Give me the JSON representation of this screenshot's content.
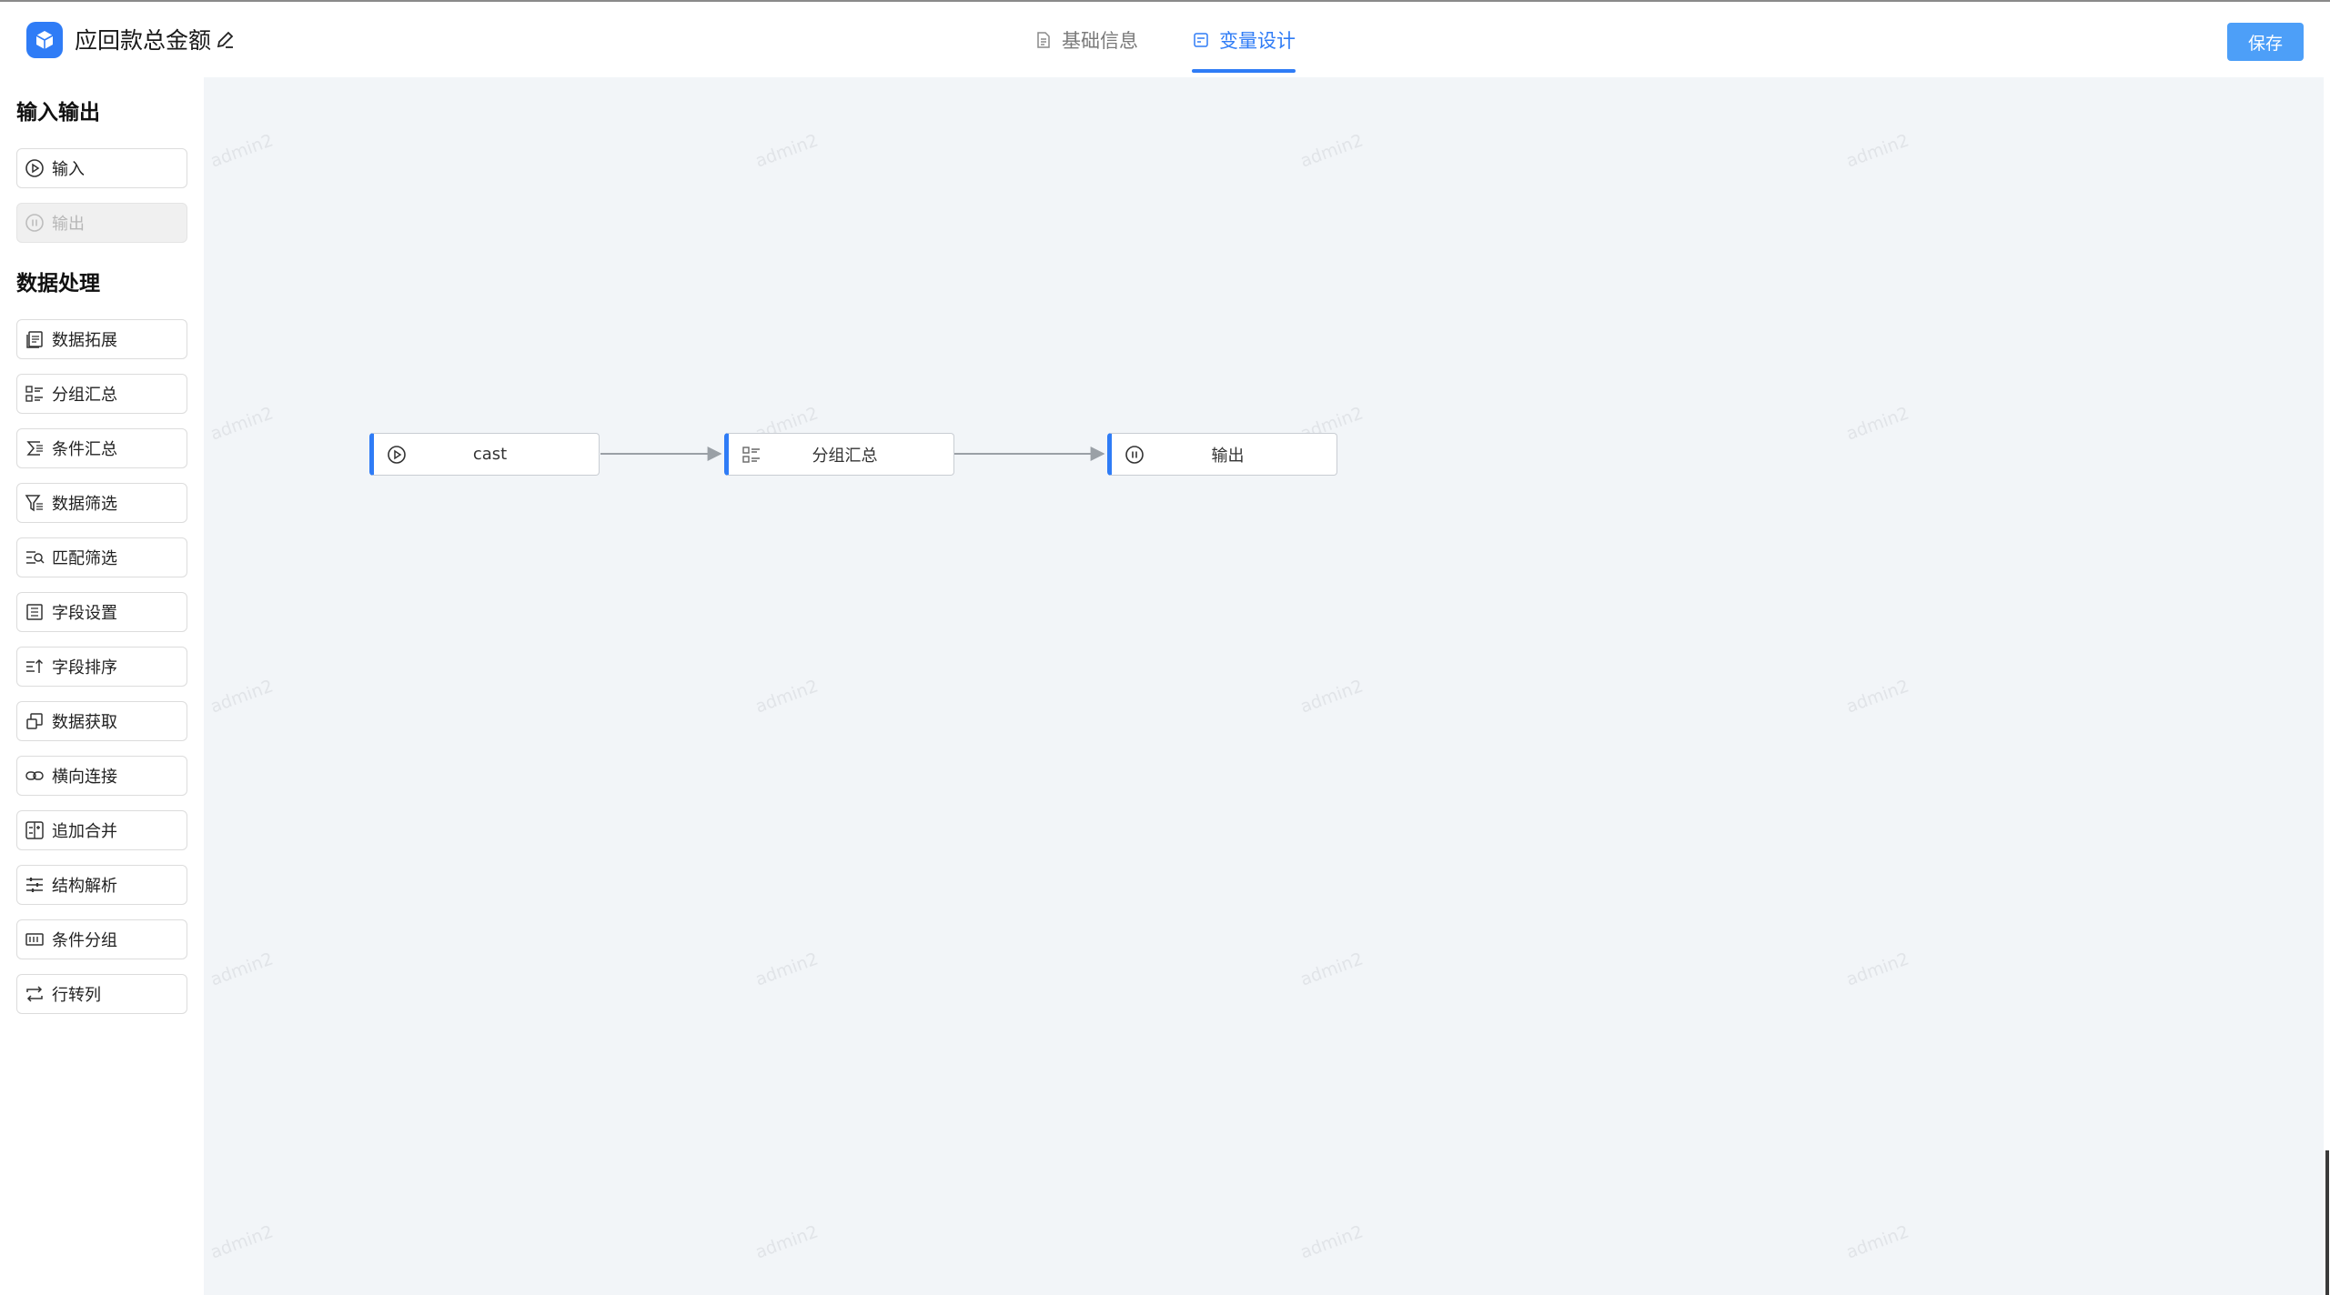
{
  "header": {
    "title": "应回款总金额",
    "tabs": [
      {
        "label": "基础信息",
        "active": false
      },
      {
        "label": "变量设计",
        "active": true
      }
    ],
    "save_label": "保存"
  },
  "sidebar": {
    "sections": [
      {
        "title": "输入输出",
        "items": [
          {
            "label": "输入",
            "icon": "play-circle-icon",
            "disabled": false
          },
          {
            "label": "输出",
            "icon": "pause-circle-icon",
            "disabled": true
          }
        ]
      },
      {
        "title": "数据处理",
        "items": [
          {
            "label": "数据拓展",
            "icon": "table-expand-icon"
          },
          {
            "label": "分组汇总",
            "icon": "group-list-icon"
          },
          {
            "label": "条件汇总",
            "icon": "sigma-icon"
          },
          {
            "label": "数据筛选",
            "icon": "filter-icon"
          },
          {
            "label": "匹配筛选",
            "icon": "match-filter-icon"
          },
          {
            "label": "字段设置",
            "icon": "field-settings-icon"
          },
          {
            "label": "字段排序",
            "icon": "sort-icon"
          },
          {
            "label": "数据获取",
            "icon": "data-fetch-icon"
          },
          {
            "label": "横向连接",
            "icon": "link-icon"
          },
          {
            "label": "追加合并",
            "icon": "merge-icon"
          },
          {
            "label": "结构解析",
            "icon": "sliders-icon"
          },
          {
            "label": "条件分组",
            "icon": "condition-group-icon"
          },
          {
            "label": "行转列",
            "icon": "row-to-column-icon"
          }
        ]
      }
    ]
  },
  "canvas": {
    "watermark_text": "admin2",
    "nodes": [
      {
        "label": "cast",
        "icon": "play-circle-icon"
      },
      {
        "label": "分组汇总",
        "icon": "group-list-icon"
      },
      {
        "label": "输出",
        "icon": "pause-circle-icon"
      }
    ]
  },
  "colors": {
    "accent": "#2f7cf6",
    "save_button": "#4d9ff8",
    "canvas_bg": "#f2f5f8"
  }
}
